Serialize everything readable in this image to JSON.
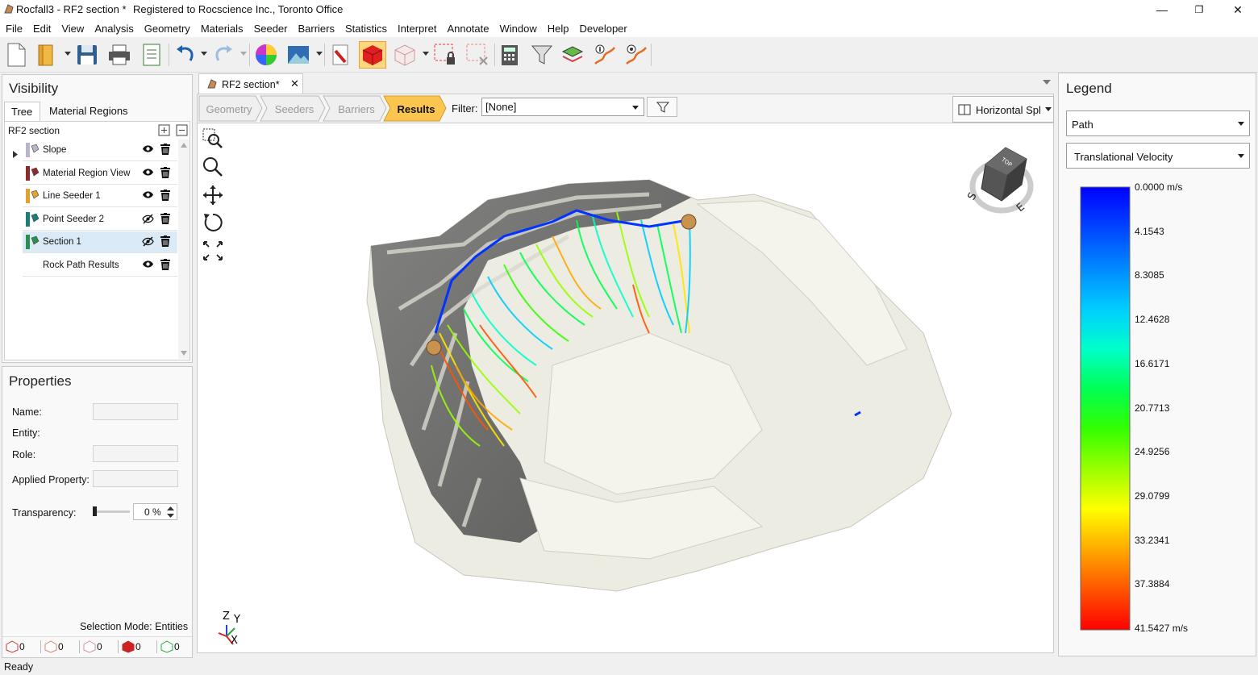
{
  "window": {
    "title": "Rocfall3 - RF2 section *",
    "registration": "Registered to Rocscience Inc., Toronto Office",
    "minimize": "—",
    "restore": "❐",
    "close": "✕"
  },
  "menu": [
    "File",
    "Edit",
    "View",
    "Analysis",
    "Geometry",
    "Materials",
    "Seeder",
    "Barriers",
    "Statistics",
    "Interpret",
    "Annotate",
    "Window",
    "Help",
    "Developer"
  ],
  "toolbar": {
    "icons": [
      "new-icon",
      "open-icon",
      "save-icon",
      "print-icon",
      "report-icon",
      "undo-icon",
      "redo-icon",
      "color-wheel-icon",
      "image-icon",
      "pick-icon",
      "solid-view-icon",
      "wireframe-view-icon",
      "lock-selection-icon",
      "clear-selection-icon",
      "calculator-icon",
      "filter-icon",
      "map-layers-icon",
      "path-info-icon",
      "path-query-icon"
    ],
    "active": "solid-view-icon"
  },
  "visibility": {
    "title": "Visibility",
    "tabs": [
      "Tree",
      "Material Regions"
    ],
    "active_tab": "Tree",
    "root": "RF2 section",
    "items": [
      {
        "label": "Slope",
        "visible": true,
        "icon": "slope-icon",
        "color": "#b7b7c9"
      },
      {
        "label": "Material Region View",
        "visible": true,
        "icon": "material-region-icon",
        "color": "#8f2a2a"
      },
      {
        "label": "Line Seeder 1",
        "visible": true,
        "icon": "line-seeder-icon",
        "color": "#e3a12f"
      },
      {
        "label": "Point Seeder 2",
        "visible": false,
        "icon": "point-seeder-icon",
        "color": "#1b7f79"
      },
      {
        "label": "Section 1",
        "visible": false,
        "icon": "section-icon",
        "color": "#2a8f4f",
        "selected": true
      },
      {
        "label": "Rock Path Results",
        "visible": true,
        "icon": "",
        "color": ""
      }
    ]
  },
  "properties": {
    "title": "Properties",
    "name_label": "Name:",
    "entity_label": "Entity:",
    "role_label": "Role:",
    "applied_property_label": "Applied Property:",
    "transparency_label": "Transparency:",
    "transparency_value": "0 %",
    "selection_mode": "Selection Mode:  Entities",
    "counts": [
      "0",
      "0",
      "0",
      "0",
      "0"
    ]
  },
  "status": "Ready",
  "viewport": {
    "tab_label": "RF2 section*",
    "tab_close": "✕",
    "steps": [
      "Geometry",
      "Seeders",
      "Barriers",
      "Results"
    ],
    "active_step": "Results",
    "filter_label": "Filter:",
    "filter_value": "[None]",
    "split_label": "Horizontal Spl",
    "axes": {
      "z": "Z",
      "y": "Y",
      "x": "X"
    },
    "cube": {
      "top": "TOP",
      "s": "S",
      "e": "E"
    }
  },
  "legend": {
    "title": "Legend",
    "mode": "Path",
    "variable": "Translational Velocity",
    "ticks": [
      "0.0000 m/s",
      "4.1543",
      "8.3085",
      "12.4628",
      "16.6171",
      "20.7713",
      "24.9256",
      "29.0799",
      "33.2341",
      "37.3884",
      "41.5427 m/s"
    ],
    "colors": [
      "#0000ff",
      "#0044ff",
      "#0088ff",
      "#00ccff",
      "#00ffcc",
      "#00ff55",
      "#33ff00",
      "#99ff00",
      "#ffff00",
      "#ffaa00",
      "#ff5500",
      "#ff0000"
    ]
  }
}
